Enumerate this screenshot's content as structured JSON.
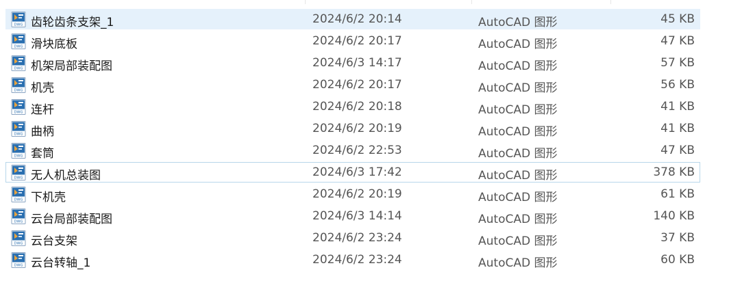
{
  "files": [
    {
      "name": "齿轮齿条支架_1",
      "date": "2024/6/2 20:14",
      "type": "AutoCAD 图形",
      "size": "45 KB",
      "icon": "dwg-file-icon",
      "selected": true,
      "focused": false
    },
    {
      "name": "滑块底板",
      "date": "2024/6/2 20:17",
      "type": "AutoCAD 图形",
      "size": "47 KB",
      "icon": "dwg-file-icon",
      "selected": false,
      "focused": false
    },
    {
      "name": "机架局部装配图",
      "date": "2024/6/3 14:17",
      "type": "AutoCAD 图形",
      "size": "57 KB",
      "icon": "dwg-file-icon",
      "selected": false,
      "focused": false
    },
    {
      "name": "机壳",
      "date": "2024/6/2 20:17",
      "type": "AutoCAD 图形",
      "size": "56 KB",
      "icon": "dwg-file-icon",
      "selected": false,
      "focused": false
    },
    {
      "name": "连杆",
      "date": "2024/6/2 20:18",
      "type": "AutoCAD 图形",
      "size": "41 KB",
      "icon": "dwg-file-icon",
      "selected": false,
      "focused": false
    },
    {
      "name": "曲柄",
      "date": "2024/6/2 20:19",
      "type": "AutoCAD 图形",
      "size": "41 KB",
      "icon": "dwg-file-icon",
      "selected": false,
      "focused": false
    },
    {
      "name": "套筒",
      "date": "2024/6/2 22:53",
      "type": "AutoCAD 图形",
      "size": "47 KB",
      "icon": "dwg-file-icon",
      "selected": false,
      "focused": false
    },
    {
      "name": "无人机总装图",
      "date": "2024/6/3 17:42",
      "type": "AutoCAD 图形",
      "size": "378 KB",
      "icon": "dwg-file-icon",
      "selected": false,
      "focused": true
    },
    {
      "name": "下机壳",
      "date": "2024/6/2 20:19",
      "type": "AutoCAD 图形",
      "size": "61 KB",
      "icon": "dwg-file-icon",
      "selected": false,
      "focused": false
    },
    {
      "name": "云台局部装配图",
      "date": "2024/6/3 14:14",
      "type": "AutoCAD 图形",
      "size": "140 KB",
      "icon": "dwg-file-icon",
      "selected": false,
      "focused": false
    },
    {
      "name": "云台支架",
      "date": "2024/6/2 23:24",
      "type": "AutoCAD 图形",
      "size": "37 KB",
      "icon": "dwg-file-icon",
      "selected": false,
      "focused": false
    },
    {
      "name": "云台转轴_1",
      "date": "2024/6/2 23:24",
      "type": "AutoCAD 图形",
      "size": "60 KB",
      "icon": "dwg-file-icon",
      "selected": false,
      "focused": false
    }
  ],
  "colors": {
    "selected_bg": "#e5f1fb",
    "focus_border": "#b7d6ea",
    "icon_blue": "#2a6fb0",
    "icon_orange": "#e8a33d"
  }
}
